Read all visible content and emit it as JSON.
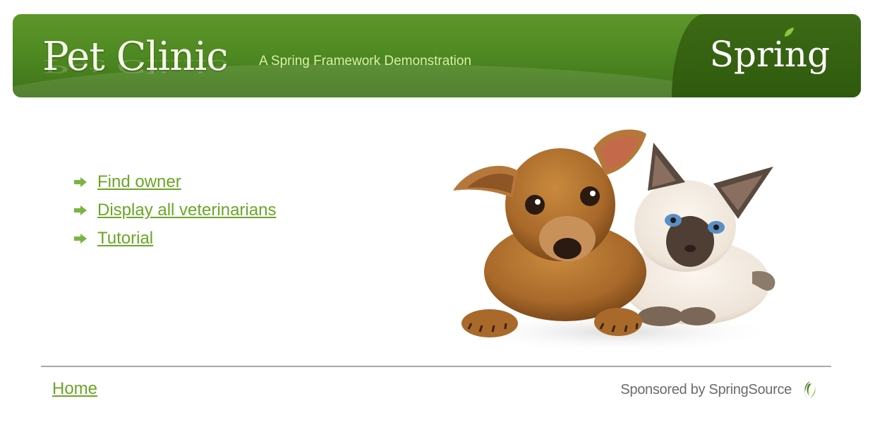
{
  "header": {
    "title": "Pet Clinic",
    "subtitle": "A Spring Framework Demonstration",
    "logo_text": "Spring",
    "background_color": "#4f8a22",
    "panel_color": "#2f5a0e"
  },
  "nav": {
    "link_color": "#6aa626",
    "items": [
      {
        "label": "Find owner",
        "icon": "arrow-right-icon"
      },
      {
        "label": "Display all veterinarians",
        "icon": "arrow-right-icon"
      },
      {
        "label": "Tutorial",
        "icon": "arrow-right-icon"
      }
    ]
  },
  "hero_image": {
    "subject": "puppy-and-kitten-photo"
  },
  "footer": {
    "home_label": "Home",
    "sponsor_text": "Sponsored by SpringSource",
    "sponsor_icon": "springsource-logo-icon"
  }
}
